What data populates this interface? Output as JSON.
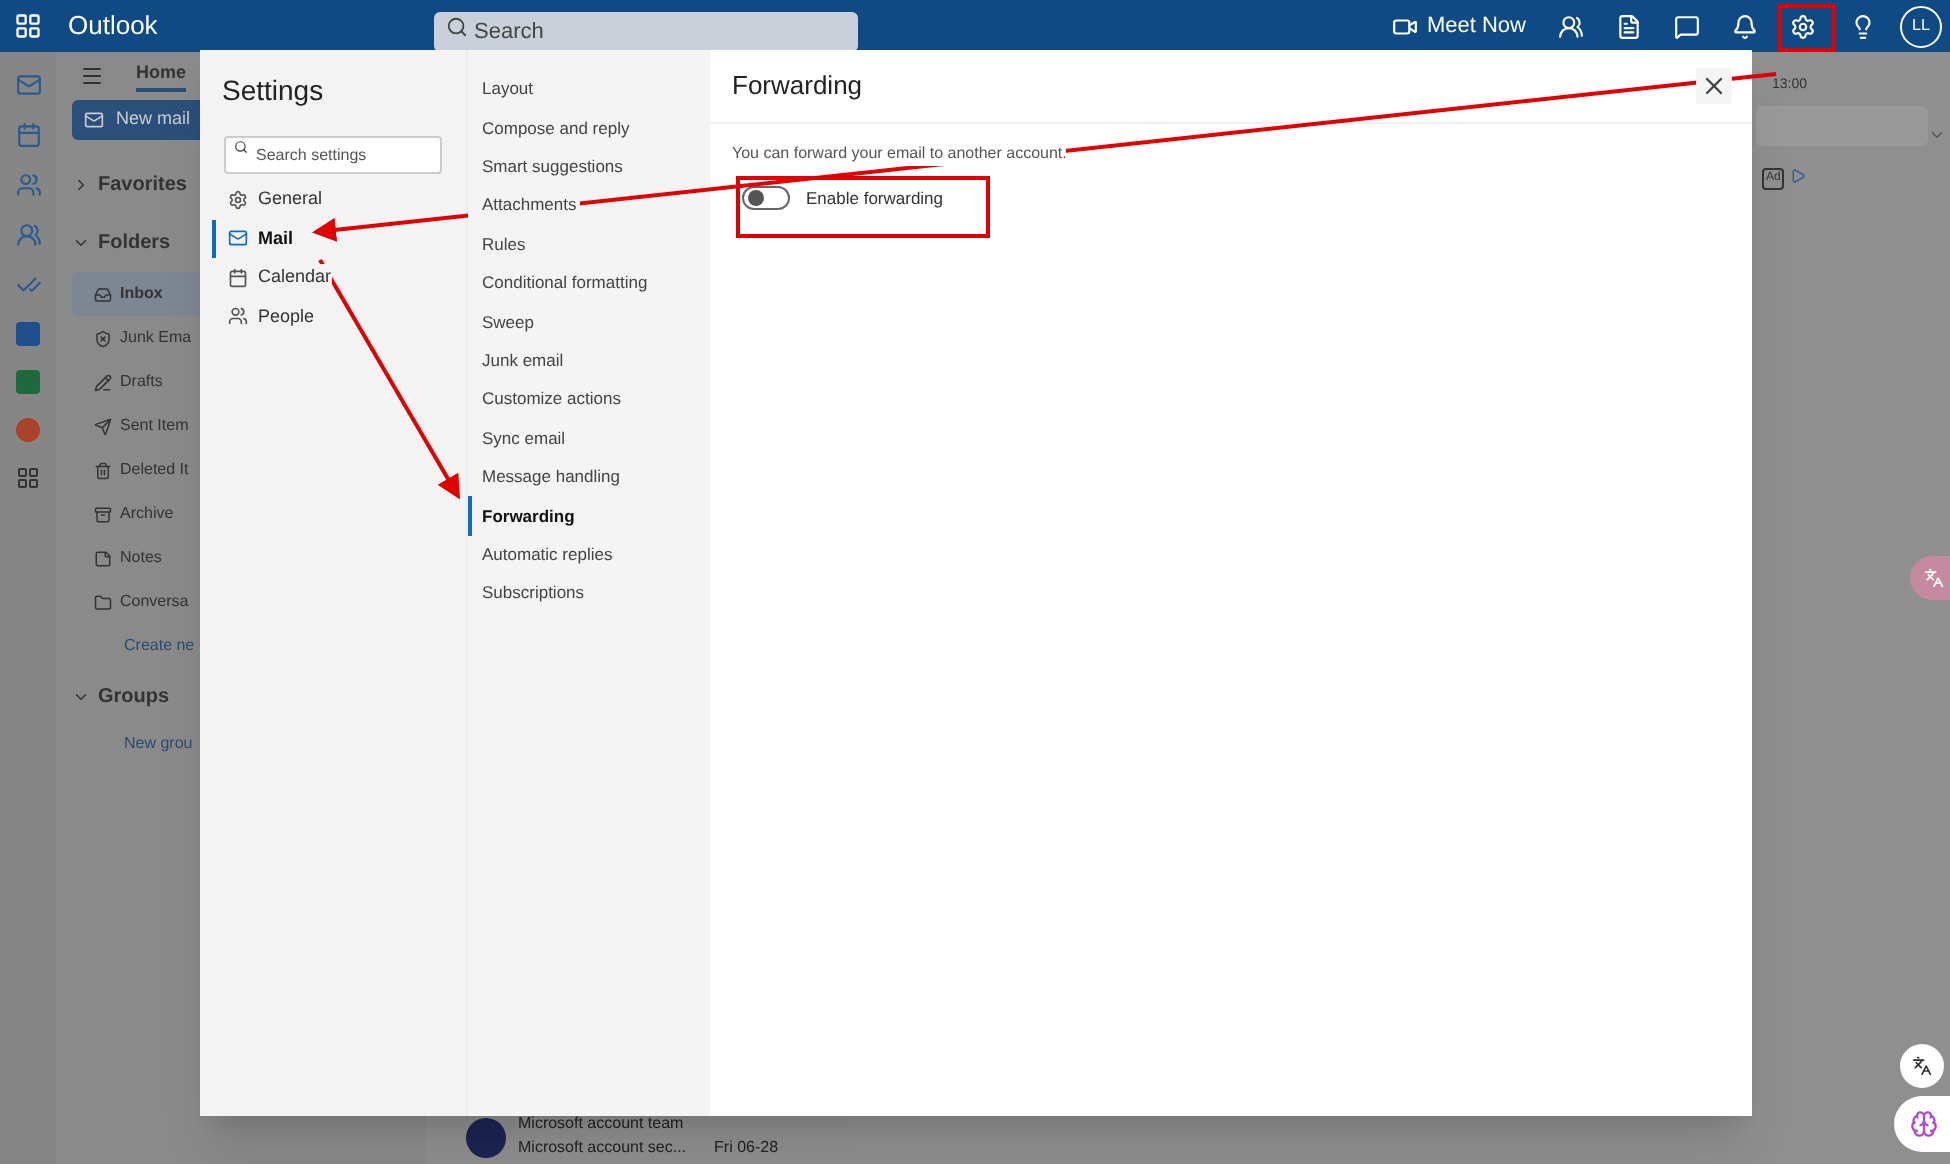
{
  "header": {
    "app_name": "Outlook",
    "search_placeholder": "Search",
    "meet_now": "Meet Now",
    "avatar": "LL"
  },
  "ribbon": {
    "tab": "Home",
    "new_mail": "New mail"
  },
  "folder_pane": {
    "sections": [
      {
        "label": "Favorites",
        "expanded": false
      },
      {
        "label": "Folders",
        "expanded": true
      }
    ],
    "folders": [
      {
        "label": "Inbox",
        "selected": true
      },
      {
        "label": "Junk Ema",
        "selected": false
      },
      {
        "label": "Drafts",
        "selected": false
      },
      {
        "label": "Sent Item",
        "selected": false
      },
      {
        "label": "Deleted It",
        "selected": false
      },
      {
        "label": "Archive",
        "selected": false
      },
      {
        "label": "Notes",
        "selected": false
      },
      {
        "label": "Conversa",
        "selected": false
      }
    ],
    "create_new": "Create ne",
    "groups": {
      "label": "Groups",
      "expanded": true
    },
    "new_group": "New grou"
  },
  "message": {
    "sender": "Microsoft account team",
    "subject": "Microsoft account sec...",
    "date": "Fri 06-28"
  },
  "reading_pane": {
    "time": "13:00",
    "ad": "Ad"
  },
  "settings": {
    "title": "Settings",
    "search_placeholder": "Search settings",
    "categories": [
      {
        "label": "General",
        "selected": false
      },
      {
        "label": "Mail",
        "selected": true
      },
      {
        "label": "Calendar",
        "selected": false
      },
      {
        "label": "People",
        "selected": false
      }
    ],
    "subsections": [
      {
        "label": "Layout",
        "selected": false
      },
      {
        "label": "Compose and reply",
        "selected": false
      },
      {
        "label": "Smart suggestions",
        "selected": false
      },
      {
        "label": "Attachments",
        "selected": false
      },
      {
        "label": "Rules",
        "selected": false
      },
      {
        "label": "Conditional formatting",
        "selected": false
      },
      {
        "label": "Sweep",
        "selected": false
      },
      {
        "label": "Junk email",
        "selected": false
      },
      {
        "label": "Customize actions",
        "selected": false
      },
      {
        "label": "Sync email",
        "selected": false
      },
      {
        "label": "Message handling",
        "selected": false
      },
      {
        "label": "Forwarding",
        "selected": true
      },
      {
        "label": "Automatic replies",
        "selected": false
      },
      {
        "label": "Subscriptions",
        "selected": false
      }
    ],
    "page": {
      "title": "Forwarding",
      "description": "You can forward your email to another account.",
      "toggle": {
        "label": "Enable forwarding",
        "on": false
      }
    }
  }
}
